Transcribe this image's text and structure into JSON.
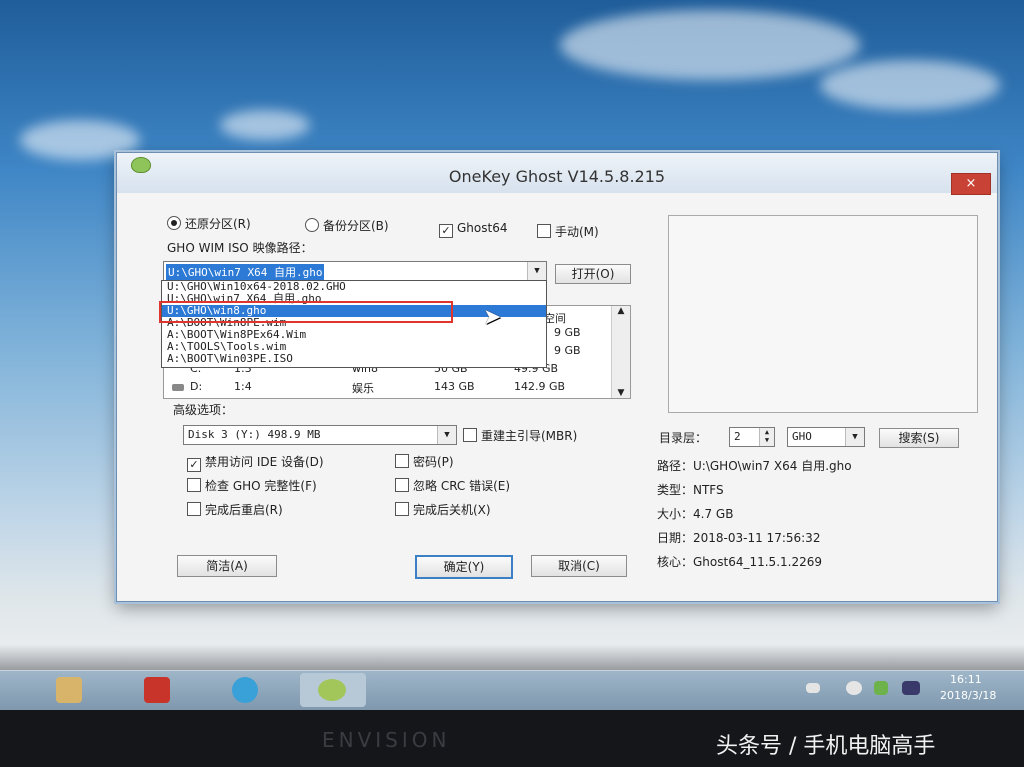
{
  "window": {
    "title": "OneKey Ghost V14.5.8.215",
    "close": "×"
  },
  "mode": {
    "restore": "还原分区(R)",
    "backup": "备份分区(B)",
    "ghost64": "Ghost64",
    "manual": "手动(M)"
  },
  "image_path": {
    "label": "GHO WIM ISO 映像路径：",
    "value": "U:\\GHO\\win7 X64 自用.gho",
    "open_button": "打开(O)",
    "options": [
      "U:\\GHO\\Win10x64-2018.02.GHO",
      "U:\\GHO\\win7 X64 自用.gho",
      "U:\\GHO\\win8.gho",
      "A:\\BOOT\\Win8PE.wim",
      "A:\\BOOT\\Win8PEx64.Wim",
      "A:\\TOOLS\\Tools.wim",
      "A:\\BOOT\\Win03PE.ISO"
    ]
  },
  "partitions": {
    "header_free": "空间",
    "rows": [
      {
        "drive": "",
        "part": "",
        "label": "",
        "size": "",
        "free": "9 GB"
      },
      {
        "drive": "",
        "part": "",
        "label": "",
        "size": "",
        "free": "9 GB"
      },
      {
        "drive": "C:",
        "part": "1:3",
        "label": "win8",
        "size": "50 GB",
        "free": "49.9 GB"
      },
      {
        "drive": "D:",
        "part": "1:4",
        "label": "娱乐",
        "size": "143 GB",
        "free": "142.9 GB"
      }
    ]
  },
  "advanced": {
    "label": "高级选项：",
    "disk": "Disk 3 (Y:) 498.9 MB",
    "rebuild_mbr": "重建主引导(MBR)",
    "disable_ide": "禁用访问 IDE 设备(D)",
    "password": "密码(P)",
    "check_gho": "检查 GHO 完整性(F)",
    "ignore_crc": "忽略 CRC 错误(E)",
    "reboot": "完成后重启(R)",
    "shutdown": "完成后关机(X)"
  },
  "dir": {
    "label": "目录层：",
    "value": "2",
    "type": "GHO",
    "search": "搜索(S)"
  },
  "info": {
    "path": "路径：U:\\GHO\\win7 X64 自用.gho",
    "type": "类型：NTFS",
    "size": "大小：4.7 GB",
    "date": "日期：2018-03-11   17:56:32",
    "core": "核心：Ghost64_11.5.1.2269"
  },
  "buttons": {
    "simple": "简洁(A)",
    "ok": "确定(Y)",
    "cancel": "取消(C)"
  },
  "clock": {
    "time": "16:11",
    "date": "2018/3/18"
  },
  "bezel_brand": "ENVISION",
  "watermark": "头条号 / 手机电脑高手",
  "colors": {
    "selection": "#2c7ad6",
    "close": "#c84236",
    "highlight_box": "#e0342c"
  }
}
